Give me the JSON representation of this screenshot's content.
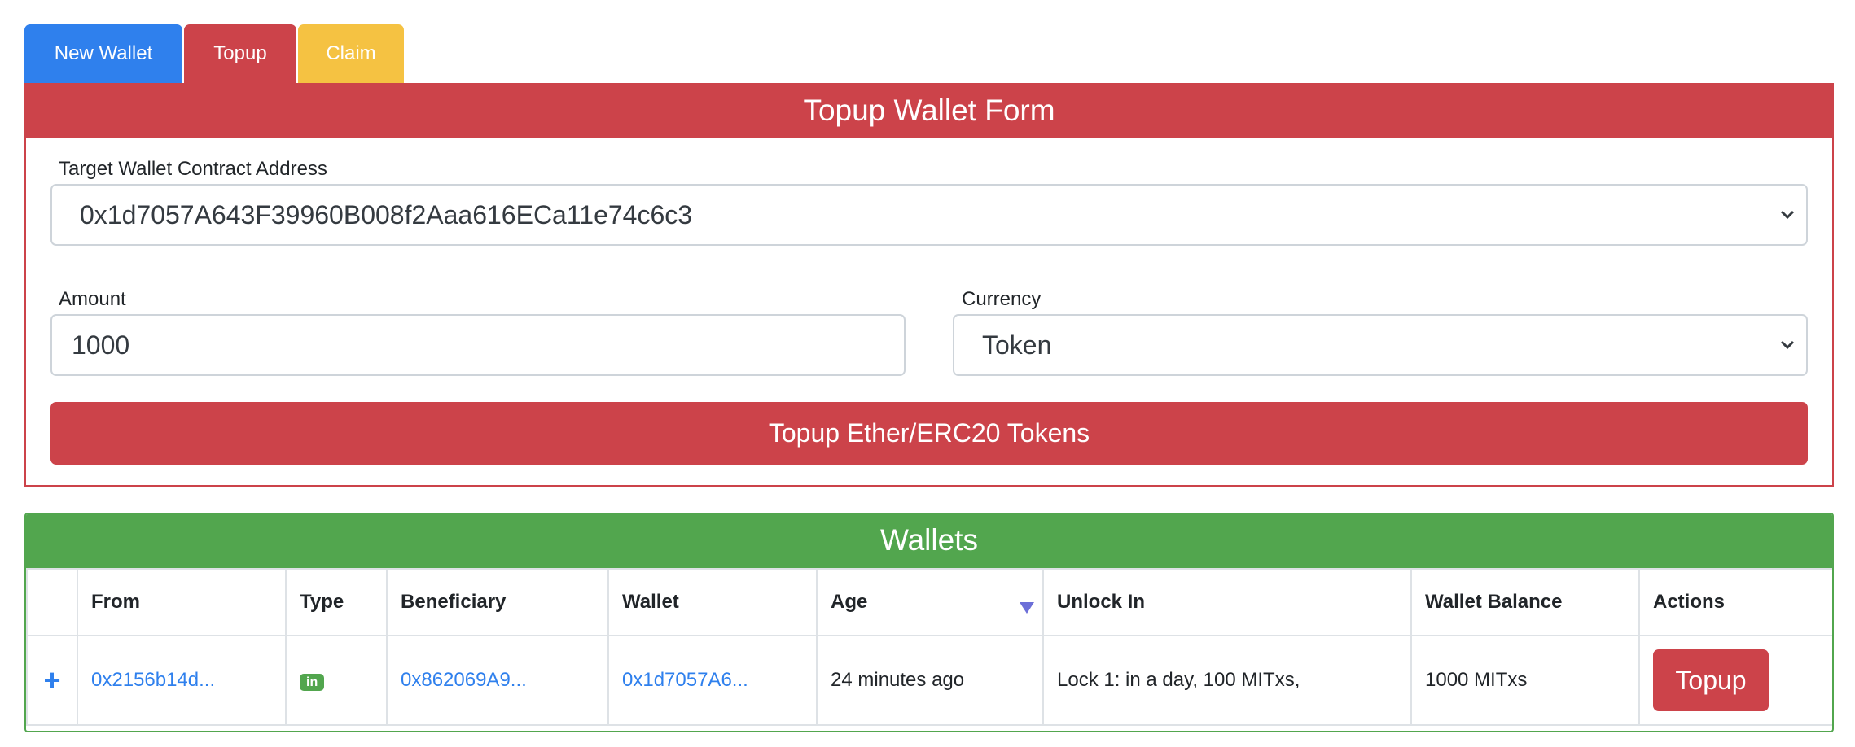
{
  "tabs": [
    {
      "label": "New Wallet",
      "color": "#2f80ed"
    },
    {
      "label": "Topup",
      "color": "#cc434a"
    },
    {
      "label": "Claim",
      "color": "#f5c242"
    }
  ],
  "form": {
    "title": "Topup Wallet Form",
    "target_label": "Target Wallet Contract Address",
    "target_value": "0x1d7057A643F39960B008f2Aaa616ECa11e74c6c3",
    "amount_label": "Amount",
    "amount_value": "1000",
    "currency_label": "Currency",
    "currency_value": "Token",
    "submit_label": "Topup Ether/ERC20 Tokens"
  },
  "wallets": {
    "title": "Wallets",
    "columns": [
      "From",
      "Type",
      "Beneficiary",
      "Wallet",
      "Age",
      "Unlock In",
      "Wallet Balance",
      "Actions"
    ],
    "sort_icon": "sort-down-icon",
    "rows": [
      {
        "expand_icon": "+",
        "from": "0x2156b14d...",
        "type": "in",
        "beneficiary": "0x862069A9...",
        "wallet": "0x1d7057A6...",
        "age": "24 minutes ago",
        "unlock_in": "Lock 1: in a day, 100 MITxs,",
        "balance": "1000 MITxs",
        "action": "Topup"
      }
    ]
  },
  "colors": {
    "primary": "#2f80ed",
    "danger": "#cc434a",
    "warning": "#f5c242",
    "success": "#52a64e"
  }
}
